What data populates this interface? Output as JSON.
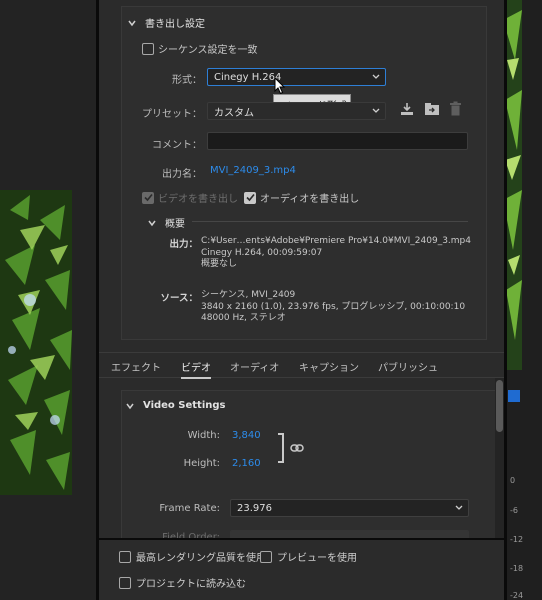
{
  "export_settings": {
    "section_title": "書き出し設定",
    "match_sequence_label": "シーケンス設定を一致",
    "format_label": "形式：",
    "format_value": "Cinegy H.264",
    "format_tooltip": "エンコード形式",
    "preset_label": "プリセット：",
    "preset_value": "カスタム",
    "comment_label": "コメント：",
    "comment_value": "",
    "output_name_label": "出力名：",
    "output_name_value": "MVI_2409_3.mp4",
    "export_video_label": "ビデオを書き出し",
    "export_video_checked": true,
    "export_video_enabled": false,
    "export_audio_label": "オーディオを書き出し",
    "export_audio_checked": true
  },
  "summary": {
    "title": "概要",
    "output_key": "出力：",
    "output_lines": "C:¥User…ents¥Adobe¥Premiere Pro¥14.0¥MVI_2409_3.mp4\nCinegy H.264, 00:09:59:07\n概要なし",
    "source_key": "ソース：",
    "source_lines": "シーケンス, MVI_2409\n3840 x 2160 (1.0), 23.976 fps, プログレッシブ, 00:10:00:10\n48000 Hz, ステレオ"
  },
  "tabs": [
    {
      "label": "エフェクト",
      "active": false
    },
    {
      "label": "ビデオ",
      "active": true
    },
    {
      "label": "オーディオ",
      "active": false
    },
    {
      "label": "キャプション",
      "active": false
    },
    {
      "label": "パブリッシュ",
      "active": false
    }
  ],
  "video_settings": {
    "title": "Video Settings",
    "width_label": "Width:",
    "width_value": "3,840",
    "height_label": "Height:",
    "height_value": "2,160",
    "frame_rate_label": "Frame Rate:",
    "frame_rate_value": "23.976",
    "field_order_label": "Field Order:"
  },
  "bottom_options": {
    "max_render_quality": "最高レンダリング品質を使用",
    "use_previews": "プレビューを使用",
    "import_into_project": "プロジェクトに読み込む"
  },
  "meter_ticks": [
    "0",
    "-6",
    "-12",
    "-18",
    "-24"
  ],
  "colors": {
    "accent_link": "#2d8ceb",
    "focus_border": "#2e7fd6",
    "panel_bg": "#2b2b2b"
  },
  "icons": [
    "chevron-down-icon",
    "download-preset-icon",
    "import-preset-icon",
    "trash-icon",
    "link-icon",
    "mouse-cursor-icon"
  ]
}
